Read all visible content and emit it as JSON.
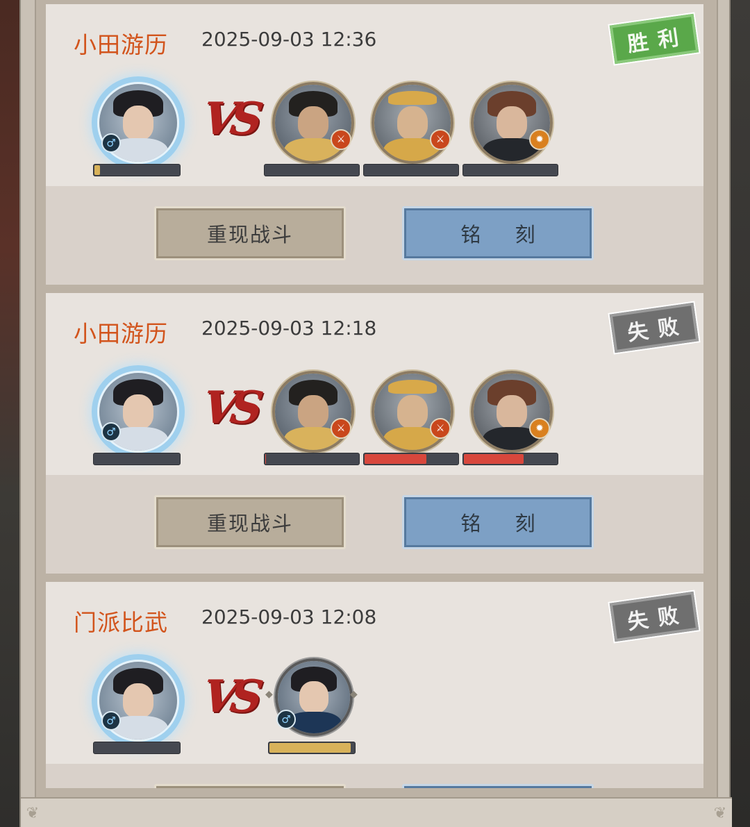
{
  "records": [
    {
      "mode": "小田游历",
      "time": "2025-09-03 12:36",
      "result": "胜利",
      "result_type": "win",
      "player_hp": 0.08,
      "enemies": [
        {
          "hp": 0.0,
          "skill_color": "#c9471c"
        },
        {
          "hp": 0.0,
          "skill_color": "#c9471c"
        },
        {
          "hp": 0.0,
          "skill_color": "#d9801f"
        }
      ],
      "buttons": {
        "replay": "重现战斗",
        "engrave": "铭 刻"
      }
    },
    {
      "mode": "小田游历",
      "time": "2025-09-03 12:18",
      "result": "失败",
      "result_type": "lose",
      "player_hp": 0.0,
      "enemies": [
        {
          "hp": 0.02,
          "skill_color": "#c9471c"
        },
        {
          "hp": 0.67,
          "skill_color": "#c9471c"
        },
        {
          "hp": 0.65,
          "skill_color": "#d9801f"
        }
      ],
      "buttons": {
        "replay": "重现战斗",
        "engrave": "铭 刻"
      }
    },
    {
      "mode": "门派比武",
      "time": "2025-09-03 12:08",
      "result": "失败",
      "result_type": "lose",
      "player_hp": 0.0,
      "opponent_hp": 0.96
    }
  ],
  "colors": {
    "mode_text": "#d2541c",
    "win_stamp": "#5aa84a",
    "lose_stamp": "#6f6f6f",
    "enemy_hp_fill": "#d8473c",
    "player_hp_fill": "#d8b25a"
  },
  "icons": {
    "male": "♂",
    "vs": "VS"
  }
}
